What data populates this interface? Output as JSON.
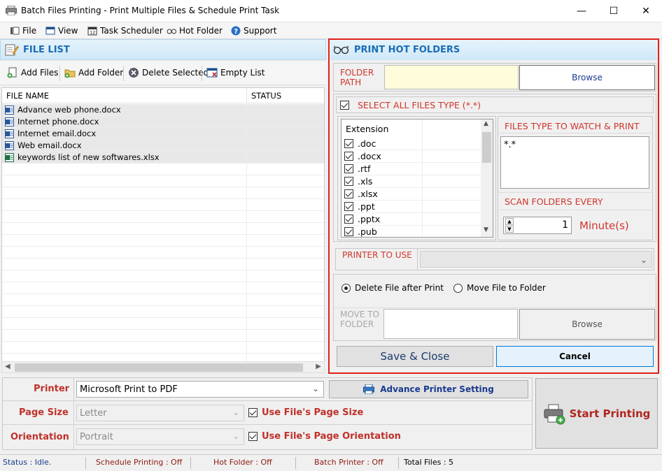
{
  "window": {
    "title": "Batch Files Printing - Print Multiple Files & Schedule Print Task",
    "minimize": "—",
    "maximize": "☐",
    "close": "✕"
  },
  "menu": {
    "file": "File",
    "view": "View",
    "task_scheduler": "Task Scheduler",
    "hot_folder": "Hot Folder",
    "support": "Support"
  },
  "file_list": {
    "header": "FILE LIST",
    "toolbar": {
      "add_files": "Add Files",
      "add_folder": "Add Folder",
      "delete_selected": "Delete Selected",
      "empty_list": "Empty List"
    },
    "columns": {
      "name": "FILE NAME",
      "status": "STATUS"
    },
    "files": [
      {
        "name": "Advance web phone.docx",
        "icon": "word-doc-icon"
      },
      {
        "name": "Internet phone.docx",
        "icon": "word-doc-icon"
      },
      {
        "name": "Internet email.docx",
        "icon": "word-doc-icon"
      },
      {
        "name": "Web email.docx",
        "icon": "word-doc-icon"
      },
      {
        "name": "keywords list of new softwares.xlsx",
        "icon": "excel-doc-icon"
      }
    ]
  },
  "hot_folders": {
    "header": "PRINT HOT FOLDERS",
    "folder_path_label": "FOLDER PATH",
    "folder_path_value": "",
    "browse": "Browse",
    "select_all": "SELECT ALL FILES TYPE (*.*)",
    "extension_header": "Extension",
    "extensions": [
      ".doc",
      ".docx",
      ".rtf",
      ".xls",
      ".xlsx",
      ".ppt",
      ".pptx",
      ".pub"
    ],
    "watch_label": "FILES TYPE TO WATCH & PRINT",
    "watch_value": "*.*",
    "scan_label": "SCAN FOLDERS EVERY",
    "scan_value": "1",
    "scan_unit": "Minute(s)",
    "printer_label": "PRINTER TO USE",
    "printer_value": "",
    "delete_after": "Delete File after Print",
    "move_to_folder": "Move File to Folder",
    "move_label": "MOVE TO FOLDER",
    "move_value": "",
    "move_browse": "Browse",
    "save_close": "Save & Close",
    "cancel": "Cancel"
  },
  "settings": {
    "printer_label": "Printer",
    "printer_value": "Microsoft Print to PDF",
    "advance_button": "Advance Printer Setting",
    "page_size_label": "Page Size",
    "page_size_value": "Letter",
    "use_page_size": "Use File's Page Size",
    "orientation_label": "Orientation",
    "orientation_value": "Portrait",
    "use_orientation": "Use File's Page Orientation",
    "start": "Start Printing"
  },
  "status": {
    "status": "Status :  Idle.",
    "schedule": "Schedule Printing : Off",
    "hot_folder": "Hot Folder : Off",
    "batch": "Batch Printer : Off",
    "total": "Total Files :  5"
  },
  "colors": {
    "accent_red": "#d0342c",
    "header_blue": "#1a6db5",
    "panel_border": "#e0201c"
  }
}
